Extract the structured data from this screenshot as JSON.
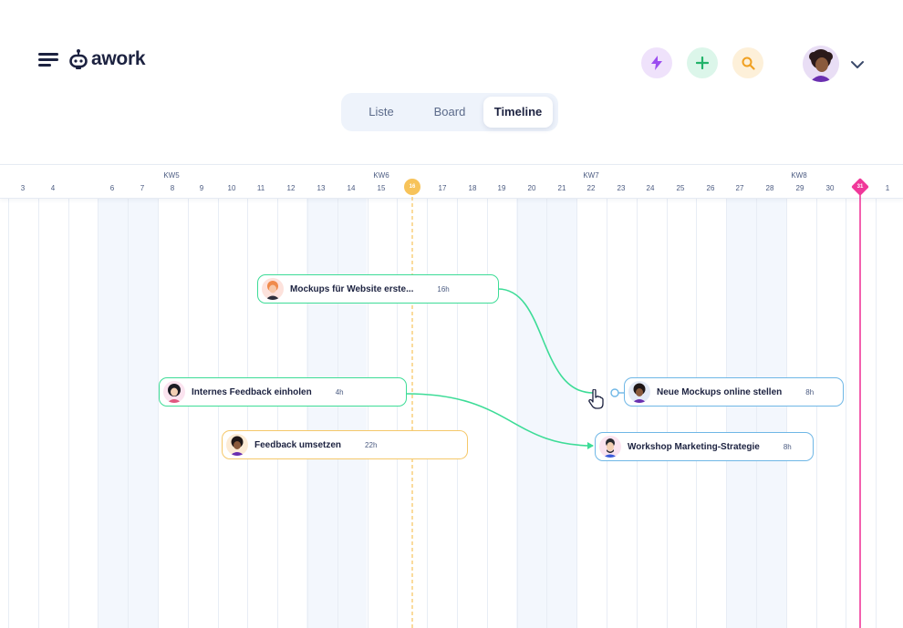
{
  "app": {
    "logo_text": "awork"
  },
  "header": {
    "icons": [
      "menu-icon",
      "lightning-icon",
      "plus-icon",
      "search-icon",
      "chevron-down-icon"
    ],
    "colors": {
      "lightning_bg": "#efe2fb",
      "lightning_fg": "#9b4df0",
      "plus_bg": "#dcf6ea",
      "plus_fg": "#22b36a",
      "search_bg": "#fdf0d9",
      "search_fg": "#f0a020"
    }
  },
  "tabs": [
    {
      "label": "Liste",
      "active": false
    },
    {
      "label": "Board",
      "active": false
    },
    {
      "label": "Timeline",
      "active": true
    }
  ],
  "timeline": {
    "weeks": [
      "KW5",
      "KW6",
      "KW7",
      "KW8"
    ],
    "days": [
      "3",
      "4",
      "6",
      "7",
      "8",
      "9",
      "10",
      "11",
      "12",
      "13",
      "14",
      "15",
      "16",
      "17",
      "18",
      "19",
      "20",
      "21",
      "22",
      "23",
      "24",
      "25",
      "26",
      "27",
      "28",
      "29",
      "30",
      "31",
      "1"
    ],
    "today": "16",
    "deadline": "31",
    "today_color": "#f7c35a",
    "deadline_color": "#f0389a"
  },
  "tasks": [
    {
      "name": "Mockups für Website erste...",
      "hours": "16h",
      "color": "#3ddc97"
    },
    {
      "name": "Internes Feedback einholen",
      "hours": "4h",
      "color": "#3ddc97"
    },
    {
      "name": "Feedback umsetzen",
      "hours": "22h",
      "color": "#f5c86a"
    },
    {
      "name": "Neue Mockups online stellen",
      "hours": "8h",
      "color": "#6fb7e6"
    },
    {
      "name": "Workshop Marketing-Strategie",
      "hours": "8h",
      "color": "#6fb7e6"
    }
  ]
}
